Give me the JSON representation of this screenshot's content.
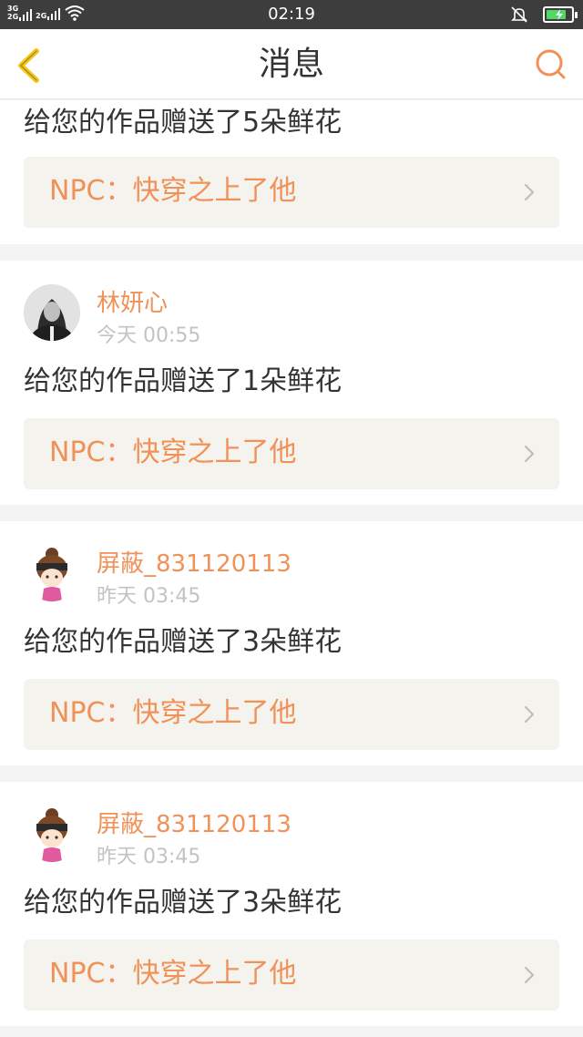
{
  "status_bar": {
    "network_1": [
      "3G",
      "2G"
    ],
    "network_2": "2G",
    "time": "02:19",
    "battery_level": 0.8
  },
  "header": {
    "title": "消息",
    "back_icon": "chevron-left-icon",
    "search_icon": "search-icon"
  },
  "colors": {
    "accent": "#f09158",
    "chevron_yellow": "#f5c518",
    "card_bg": "#f5f3ee",
    "time_gray": "#c3c3c3"
  },
  "messages": [
    {
      "gift_text": "给您的作品赠送了5朵鲜花",
      "work_title": "NPC：快穿之上了他"
    },
    {
      "username": "林妍心",
      "time": "今天 00:55",
      "gift_text": "给您的作品赠送了1朵鲜花",
      "work_title": "NPC：快穿之上了他"
    },
    {
      "username": "屏蔽_831120113",
      "time": "昨天 03:45",
      "gift_text": "给您的作品赠送了3朵鲜花",
      "work_title": "NPC：快穿之上了他"
    },
    {
      "username": "屏蔽_831120113",
      "time": "昨天 03:45",
      "gift_text": "给您的作品赠送了3朵鲜花",
      "work_title": "NPC：快穿之上了他"
    }
  ]
}
